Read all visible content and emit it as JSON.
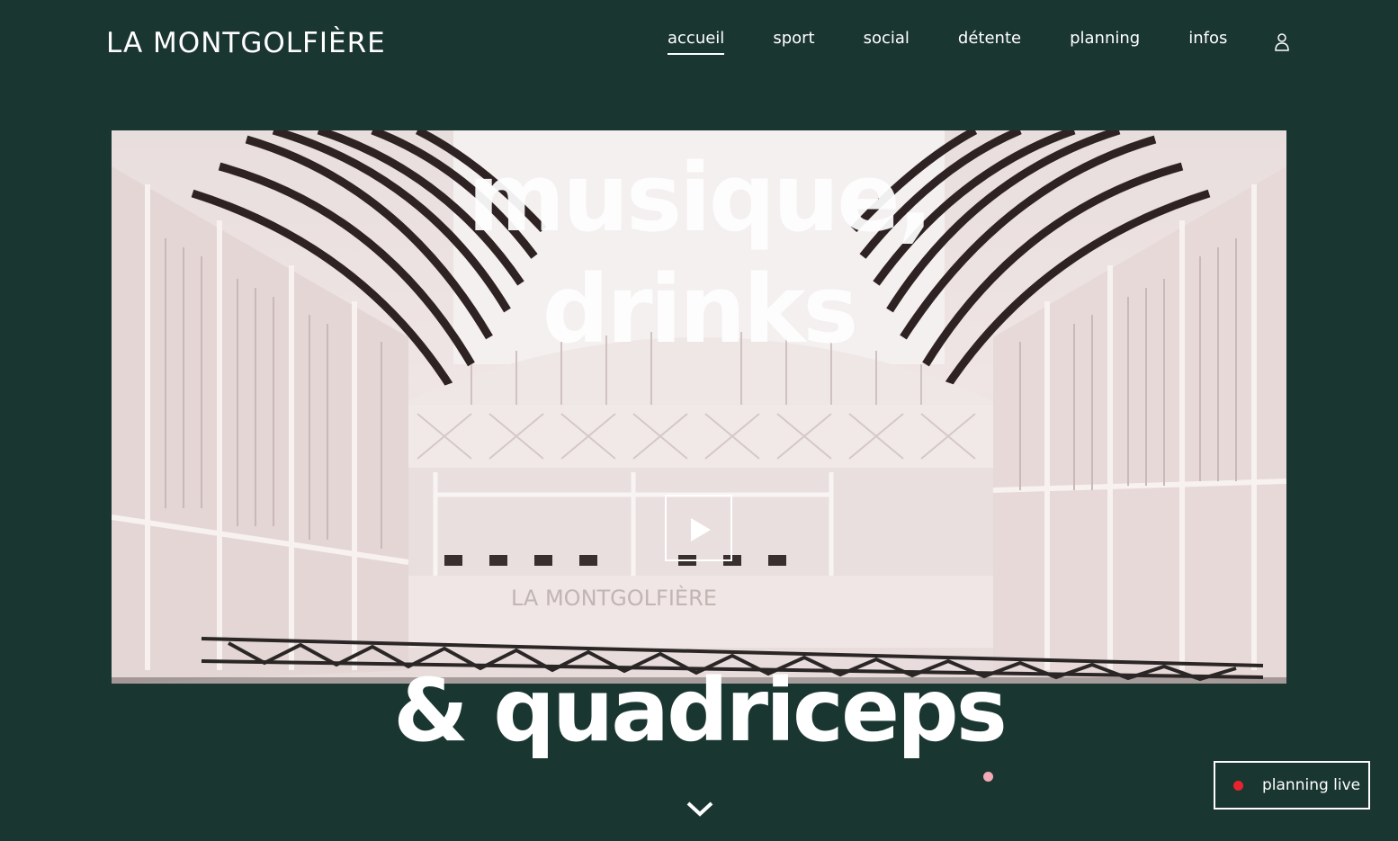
{
  "header": {
    "logo_text": "LA MONTGOLFIÈRE",
    "nav": [
      {
        "label": "accueil",
        "active": true
      },
      {
        "label": "sport",
        "active": false
      },
      {
        "label": "social",
        "active": false
      },
      {
        "label": "détente",
        "active": false
      },
      {
        "label": "planning",
        "active": false
      },
      {
        "label": "infos",
        "active": false
      }
    ],
    "account_icon": "user-icon"
  },
  "hero": {
    "headline_line1": "musique,",
    "headline_line2": "drinks",
    "headline_line3": "& quadriceps",
    "video_sign_text": "LA MONTGOLFIÈRE",
    "play_icon": "play-icon"
  },
  "footer": {
    "scroll_icon": "chevron-down-icon",
    "planning_live_label": "planning live",
    "live_indicator_color": "#e8232e"
  },
  "colors": {
    "background": "#1a3631",
    "text": "#ffffff",
    "accent_dot": "#f2aab6"
  }
}
